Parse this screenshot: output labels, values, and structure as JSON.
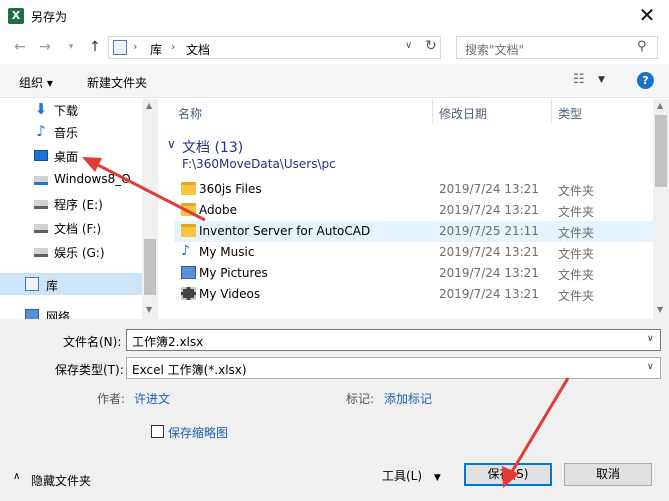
{
  "window": {
    "title": "另存为",
    "app_icon_letter": "X"
  },
  "address": {
    "crumbs": [
      "库",
      "文档"
    ],
    "search_placeholder": "搜索\"文档\""
  },
  "toolbar": {
    "organize": "组织 ▾",
    "new_folder": "新建文件夹"
  },
  "nav": {
    "items": [
      {
        "label": "下载",
        "icon": "download-icon"
      },
      {
        "label": "音乐",
        "icon": "music-icon"
      },
      {
        "label": "桌面",
        "icon": "desktop-icon"
      },
      {
        "label": "Windows8_O",
        "icon": "drive-c-icon"
      },
      {
        "label": "程序 (E:)",
        "icon": "drive-icon"
      },
      {
        "label": "文档 (F:)",
        "icon": "drive-icon"
      },
      {
        "label": "娱乐 (G:)",
        "icon": "drive-icon"
      },
      {
        "label": "库",
        "icon": "library-icon"
      },
      {
        "label": "网络",
        "icon": "network-icon"
      }
    ]
  },
  "list": {
    "columns": {
      "name": "名称",
      "date": "修改日期",
      "type": "类型"
    },
    "group": {
      "title": "文档 (13)",
      "path": "F:\\360MoveData\\Users\\pc"
    },
    "rows": [
      {
        "name": "360js Files",
        "date": "2019/7/24 13:21",
        "type": "文件夹",
        "icon": "folder-icon"
      },
      {
        "name": "Adobe",
        "date": "2019/7/24 13:21",
        "type": "文件夹",
        "icon": "folder-icon"
      },
      {
        "name": "Inventor Server for AutoCAD",
        "date": "2019/7/25 21:11",
        "type": "文件夹",
        "icon": "folder-icon"
      },
      {
        "name": "My Music",
        "date": "2019/7/24 13:21",
        "type": "文件夹",
        "icon": "music-folder-icon"
      },
      {
        "name": "My Pictures",
        "date": "2019/7/24 13:21",
        "type": "文件夹",
        "icon": "pictures-folder-icon"
      },
      {
        "name": "My Videos",
        "date": "2019/7/24 13:21",
        "type": "文件夹",
        "icon": "videos-folder-icon"
      }
    ]
  },
  "form": {
    "filename_label": "文件名(N):",
    "filename_value": "工作簿2.xlsx",
    "type_label": "保存类型(T):",
    "type_value": "Excel 工作簿(*.xlsx)",
    "author_label": "作者:",
    "author_value": "许进文",
    "tags_label": "标记:",
    "tags_value": "添加标记",
    "thumbnail_label": "保存缩略图",
    "hide_folders": "隐藏文件夹",
    "tools": "工具(L)",
    "save": "保存(S)",
    "cancel": "取消"
  },
  "colors": {
    "accent": "#0078d7",
    "annotation": "#e53935"
  }
}
